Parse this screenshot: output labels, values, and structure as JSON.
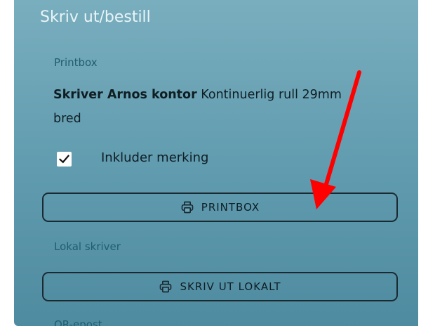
{
  "panel": {
    "title": "Skriv ut/bestill"
  },
  "printbox_section": {
    "label": "Printbox",
    "printer_name": "Skriver Arnos kontor",
    "printer_desc": "Kontinuerlig rull 29mm bred",
    "include_marking": {
      "label": "Inkluder merking",
      "checked": true
    },
    "button_label": "PRINTBOX",
    "button_icon": "printer-icon"
  },
  "local_section": {
    "label": "Lokal skriver",
    "button_label": "SKRIV UT LOKALT",
    "button_icon": "printer-icon"
  },
  "qr_section": {
    "label": "QR-epost"
  },
  "annotation": {
    "arrow_color": "#ff0000"
  }
}
